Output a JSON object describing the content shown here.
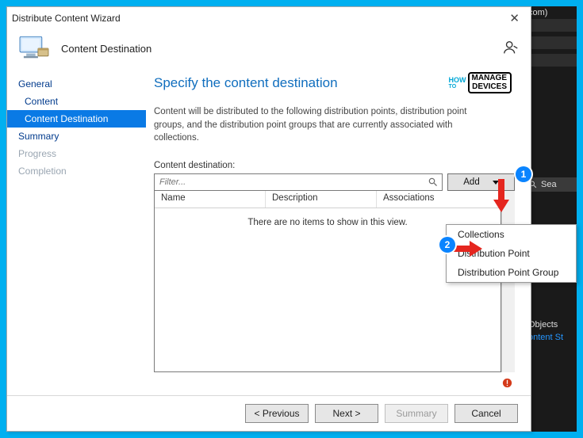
{
  "dialog": {
    "title": "Distribute Content Wizard",
    "header_label": "Content Destination"
  },
  "sidebar": {
    "items": [
      {
        "label": "General",
        "type": "grp"
      },
      {
        "label": "Content",
        "type": "item"
      },
      {
        "label": "Content Destination",
        "type": "active"
      },
      {
        "label": "Summary",
        "type": "grp"
      },
      {
        "label": "Progress",
        "type": "dim"
      },
      {
        "label": "Completion",
        "type": "dim"
      }
    ]
  },
  "main": {
    "heading": "Specify the content destination",
    "description": "Content will be distributed to the following distribution points, distribution point groups, and the distribution point groups that are currently associated with collections.",
    "dest_label": "Content destination:",
    "filter_placeholder": "Filter...",
    "add_label": "Add",
    "columns": {
      "name": "Name",
      "desc": "Description",
      "assoc": "Associations"
    },
    "empty_text": "There are no items to show in this view."
  },
  "popup": {
    "items": [
      "Collections",
      "Distribution Point",
      "Distribution Point Group"
    ]
  },
  "footer": {
    "previous": "< Previous",
    "next": "Next >",
    "summary": "Summary",
    "cancel": "Cancel"
  },
  "watermark": {
    "how": "HOW",
    "to": "TO",
    "manage": "MANAGE",
    "devices": "DEVICES"
  },
  "background": {
    "top_tag": "com)",
    "search": "Sea",
    "objects": "Objects",
    "link": "ontent St"
  },
  "annotations": {
    "badge1": "1",
    "badge2": "2"
  }
}
